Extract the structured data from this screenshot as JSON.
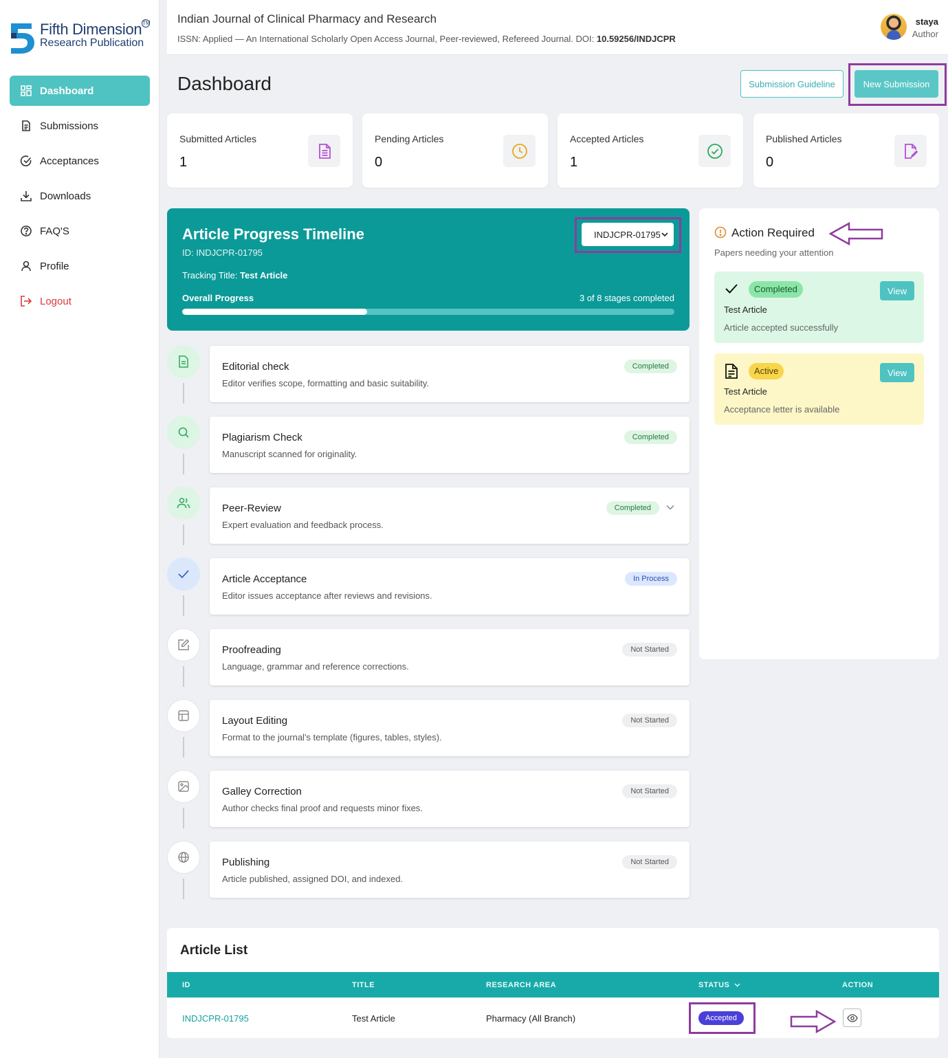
{
  "brand": {
    "line1": "Fifth Dimension",
    "line2": "Research Publication",
    "tm": "TM"
  },
  "sidebar": {
    "items": [
      {
        "label": "Dashboard",
        "icon": "grid-icon"
      },
      {
        "label": "Submissions",
        "icon": "document-icon"
      },
      {
        "label": "Acceptances",
        "icon": "check-circle-icon"
      },
      {
        "label": "Downloads",
        "icon": "download-icon"
      },
      {
        "label": "FAQ'S",
        "icon": "question-circle-icon"
      },
      {
        "label": "Profile",
        "icon": "user-icon"
      },
      {
        "label": "Logout",
        "icon": "logout-icon"
      }
    ],
    "active": "Dashboard"
  },
  "header": {
    "journal_title": "Indian Journal of Clinical Pharmacy and Research",
    "journal_sub_prefix": "ISSN: Applied — An International Scholarly Open Access Journal, Peer-reviewed, Refereed Journal. DOI: ",
    "doi": "10.59256/INDJCPR",
    "user_name": "staya",
    "user_role": "Author"
  },
  "page": {
    "title": "Dashboard",
    "guideline_label": "Submission Guideline",
    "new_submission_label": "New Submission"
  },
  "stats": [
    {
      "label": "Submitted Articles",
      "value": "1",
      "icon": "file-text-icon",
      "color": "#b44fd6"
    },
    {
      "label": "Pending Articles",
      "value": "0",
      "icon": "clock-icon",
      "color": "#e8a71c"
    },
    {
      "label": "Accepted Articles",
      "value": "1",
      "icon": "check-circle-icon",
      "color": "#2eaa5b"
    },
    {
      "label": "Published Articles",
      "value": "0",
      "icon": "file-edit-icon",
      "color": "#b44fd6"
    }
  ],
  "timeline": {
    "title": "Article Progress Timeline",
    "id_line": "ID: INDJCPR-01795",
    "tracking_prefix": "Tracking Title: ",
    "tracking_title": "Test Article",
    "overall_label": "Overall Progress",
    "stages_text": "3 of 8 stages completed",
    "progress_fraction": 0.375,
    "selected_article": "INDJCPR-01795"
  },
  "stages": [
    {
      "title": "Editorial check",
      "desc": "Editor verifies scope, formatting and basic suitability.",
      "status": "Completed",
      "icon": "file-icon"
    },
    {
      "title": "Plagiarism Check",
      "desc": "Manuscript scanned for originality.",
      "status": "Completed",
      "icon": "search-icon"
    },
    {
      "title": "Peer-Review",
      "desc": "Expert evaluation and feedback process.",
      "status": "Completed",
      "icon": "users-icon"
    },
    {
      "title": "Article Acceptance",
      "desc": "Editor issues acceptance after reviews and revisions.",
      "status": "In Process",
      "icon": "check-icon"
    },
    {
      "title": "Proofreading",
      "desc": "Language, grammar and reference corrections.",
      "status": "Not Started",
      "icon": "edit-icon"
    },
    {
      "title": "Layout Editing",
      "desc": "Format to the journal's template (figures, tables, styles).",
      "status": "Not Started",
      "icon": "layout-icon"
    },
    {
      "title": "Galley Correction",
      "desc": "Author checks final proof and requests minor fixes.",
      "status": "Not Started",
      "icon": "image-icon"
    },
    {
      "title": "Publishing",
      "desc": "Article published, assigned DOI, and indexed.",
      "status": "Not Started",
      "icon": "globe-icon"
    }
  ],
  "action_required": {
    "title": "Action Required",
    "subtitle": "Papers needing your attention",
    "cards": [
      {
        "badge": "Completed",
        "title": "Test Article",
        "desc": "Article accepted successfully",
        "button": "View"
      },
      {
        "badge": "Active",
        "title": "Test Article",
        "desc": "Acceptance letter is available",
        "button": "View"
      }
    ]
  },
  "article_list": {
    "title": "Article List",
    "columns": [
      "ID",
      "TITLE",
      "RESEARCH AREA",
      "STATUS",
      "ACTION"
    ],
    "rows": [
      {
        "id": "INDJCPR-01795",
        "title": "Test Article",
        "area": "Pharmacy (All Branch)",
        "status": "Accepted"
      }
    ]
  },
  "colors": {
    "accent": "#4fc3c2",
    "teal": "#0b9a98",
    "annotation": "#8e3c9c"
  }
}
